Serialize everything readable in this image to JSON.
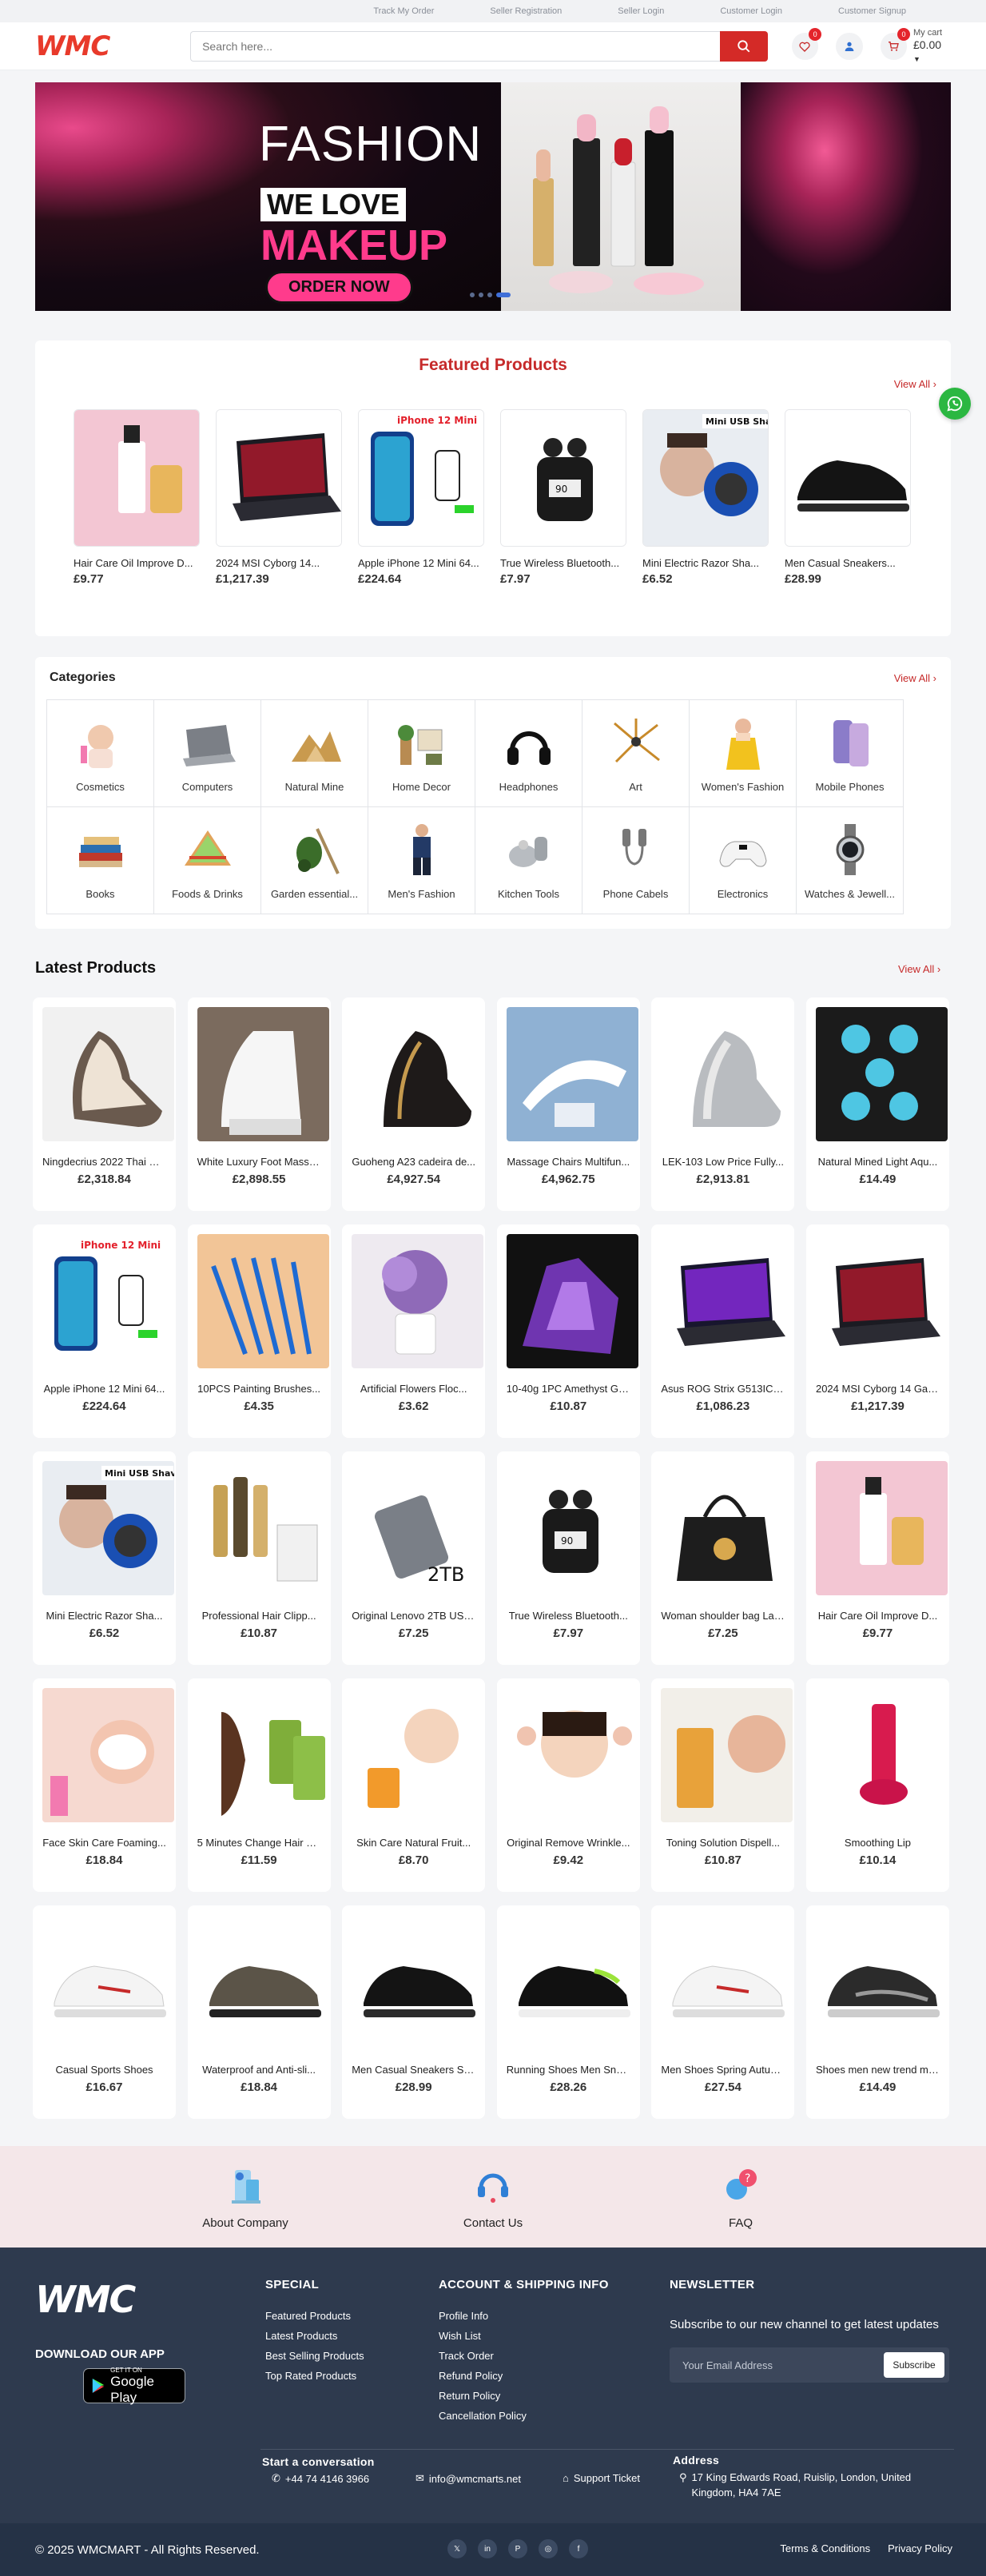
{
  "topbar": {
    "links": [
      "Track My Order",
      "Seller Registration",
      "Seller Login",
      "Customer Login",
      "Customer Signup"
    ]
  },
  "header": {
    "logo": "WMC",
    "search_placeholder": "Search here...",
    "wishlist_count": "0",
    "cart_count": "0",
    "cart_label": "My cart",
    "cart_amount": "£0.00"
  },
  "banner": {
    "line1": "FASHION",
    "line2": "WE LOVE",
    "line3": "MAKEUP",
    "cta": "ORDER NOW"
  },
  "featured": {
    "title": "Featured Products",
    "view_all": "View All",
    "items": [
      {
        "name": "Hair Care Oil Improve D...",
        "price": "£9.77"
      },
      {
        "name": "2024 MSI Cyborg 14...",
        "price": "£1,217.39"
      },
      {
        "name": "Apple iPhone 12 Mini 64...",
        "price": "£224.64"
      },
      {
        "name": "True Wireless Bluetooth...",
        "price": "£7.97"
      },
      {
        "name": "Mini Electric Razor Sha...",
        "price": "£6.52"
      },
      {
        "name": "Men Casual Sneakers...",
        "price": "£28.99"
      }
    ]
  },
  "categories": {
    "title": "Categories",
    "view_all": "View All",
    "items": [
      "Cosmetics",
      "Computers",
      "Natural Mine",
      "Home Decor",
      "Headphones",
      "Art",
      "Women's Fashion",
      "Mobile Phones",
      "Books",
      "Foods & Drinks",
      "Garden essential...",
      "Men's Fashion",
      "Kitchen Tools",
      "Phone Cabels",
      "Electronics",
      "Watches & Jewell..."
    ]
  },
  "latest": {
    "title": "Latest Products",
    "view_all": "View All",
    "items": [
      {
        "name": "Ningdecrius 2022 Thai M...",
        "price": "£2,318.84"
      },
      {
        "name": "White Luxury Foot Massa...",
        "price": "£2,898.55"
      },
      {
        "name": "Guoheng A23 cadeira de...",
        "price": "£4,927.54"
      },
      {
        "name": "Massage Chairs Multifun...",
        "price": "£4,962.75"
      },
      {
        "name": "LEK-103 Low Price Fully...",
        "price": "£2,913.81"
      },
      {
        "name": "Natural Mined Light Aqu...",
        "price": "£14.49"
      },
      {
        "name": "Apple iPhone 12 Mini 64...",
        "price": "£224.64"
      },
      {
        "name": "10PCS Painting Brushes...",
        "price": "£4.35"
      },
      {
        "name": "Artificial Flowers Floc...",
        "price": "£3.62"
      },
      {
        "name": "10-40g 1PC Amethyst Geo...",
        "price": "£10.87"
      },
      {
        "name": "Asus ROG Strix G513IC-H...",
        "price": "£1,086.23"
      },
      {
        "name": "2024 MSI Cyborg 14 Gami...",
        "price": "£1,217.39"
      },
      {
        "name": "Mini Electric Razor Sha...",
        "price": "£6.52"
      },
      {
        "name": "Professional Hair Clipp...",
        "price": "£10.87"
      },
      {
        "name": "Original Lenovo 2TB USB...",
        "price": "£7.25"
      },
      {
        "name": "True Wireless Bluetooth...",
        "price": "£7.97"
      },
      {
        "name": "Woman shoulder bag Larg...",
        "price": "£7.25"
      },
      {
        "name": "Hair Care Oil Improve D...",
        "price": "£9.77"
      },
      {
        "name": "Face Skin Care Foaming...",
        "price": "£18.84"
      },
      {
        "name": "5 Minutes Change Hair C...",
        "price": "£11.59"
      },
      {
        "name": "Skin Care Natural Fruit...",
        "price": "£8.70"
      },
      {
        "name": "Original Remove Wrinkle...",
        "price": "£9.42"
      },
      {
        "name": "Toning Solution Dispell...",
        "price": "£10.87"
      },
      {
        "name": "Smoothing Lip",
        "price": "£10.14"
      },
      {
        "name": "Casual Sports Shoes",
        "price": "£16.67"
      },
      {
        "name": "Waterproof and Anti-sli...",
        "price": "£18.84"
      },
      {
        "name": "Men Casual Sneakers Sum...",
        "price": "£28.99"
      },
      {
        "name": "Running Shoes Men Sneak...",
        "price": "£28.26"
      },
      {
        "name": "Men Shoes Spring Autumn...",
        "price": "£27.54"
      },
      {
        "name": "Shoes men new trend men...",
        "price": "£14.49"
      }
    ]
  },
  "info": {
    "about": "About Company",
    "contact": "Contact Us",
    "faq": "FAQ"
  },
  "footer": {
    "logo": "WMC",
    "download": "DOWNLOAD OUR APP",
    "gp_small": "GET IT ON",
    "gp_big": "Google Play",
    "special_title": "SPECIAL",
    "special": [
      "Featured Products",
      "Latest Products",
      "Best Selling Products",
      "Top Rated Products"
    ],
    "account_title": "ACCOUNT & SHIPPING INFO",
    "account": [
      "Profile Info",
      "Wish List",
      "Track Order",
      "Refund Policy",
      "Return Policy",
      "Cancellation Policy"
    ],
    "newsletter_title": "NEWSLETTER",
    "newsletter_text": "Subscribe to our new channel to get latest updates",
    "email_placeholder": "Your Email Address",
    "subscribe": "Subscribe",
    "conv_title": "Start a conversation",
    "phone": "+44 74 4146 3966",
    "email": "info@wmcmarts.net",
    "ticket": "Support Ticket",
    "address_title": "Address",
    "address": "17 King Edwards Road, Ruislip, London, United Kingdom, HA4 7AE"
  },
  "bottom": {
    "copyright": "© 2025 WMCMART - All Rights Reserved.",
    "terms": "Terms & Conditions",
    "privacy": "Privacy Policy"
  },
  "colors": {
    "brand": "#e83a2b",
    "accent": "#c62a2a",
    "footer": "#2e3a4e",
    "whatsapp": "#2bb741"
  }
}
